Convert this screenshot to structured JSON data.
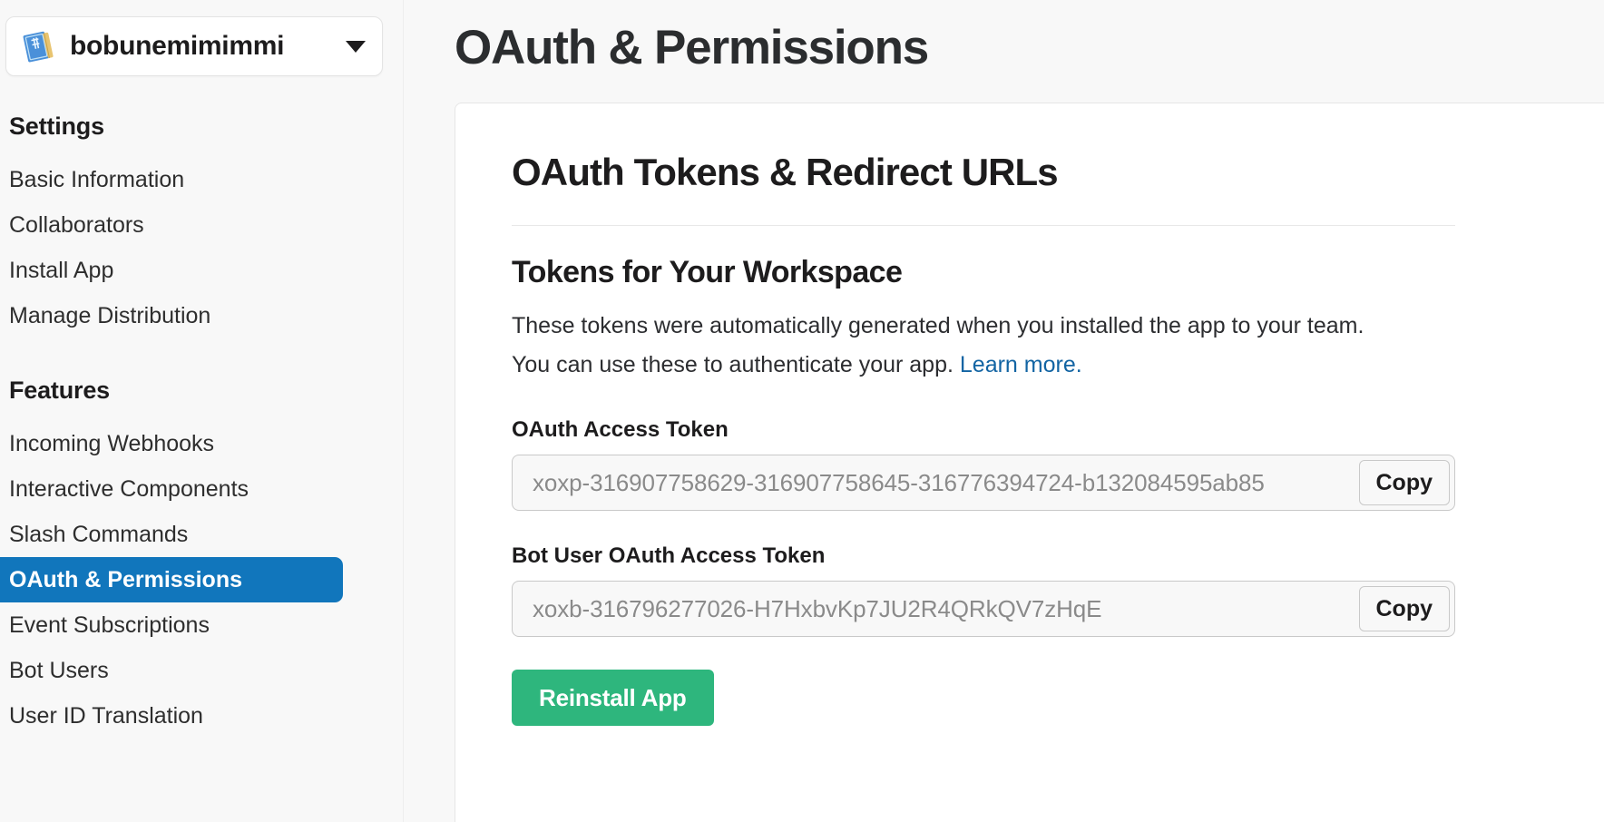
{
  "sidebar": {
    "app_selector": {
      "name": "bobunemimimmi",
      "icon": "blueprint-notebook-emoji",
      "chevron": "chevron-down-icon"
    },
    "sections": [
      {
        "id": "settings",
        "title": "Settings",
        "items": [
          {
            "label": "Basic Information",
            "active": false
          },
          {
            "label": "Collaborators",
            "active": false
          },
          {
            "label": "Install App",
            "active": false
          },
          {
            "label": "Manage Distribution",
            "active": false
          }
        ]
      },
      {
        "id": "features",
        "title": "Features",
        "items": [
          {
            "label": "Incoming Webhooks",
            "active": false
          },
          {
            "label": "Interactive Components",
            "active": false
          },
          {
            "label": "Slash Commands",
            "active": false
          },
          {
            "label": "OAuth & Permissions",
            "active": true
          },
          {
            "label": "Event Subscriptions",
            "active": false
          },
          {
            "label": "Bot Users",
            "active": false
          },
          {
            "label": "User ID Translation",
            "active": false
          }
        ]
      }
    ],
    "active_color": "#1176bc",
    "background": "#f8f8f8"
  },
  "main": {
    "page_title": "OAuth & Permissions",
    "card": {
      "title": "OAuth Tokens & Redirect URLs",
      "section_title": "Tokens for Your Workspace",
      "description_part1": "These tokens were automatically generated when you installed the app to your team. You can use these to authenticate your app. ",
      "description_link": "Learn more.",
      "link_color": "#1264a3",
      "fields": [
        {
          "label": "OAuth Access Token",
          "value": "xoxp-316907758629-316907758645-316776394724-b132084595ab85",
          "copy_label": "Copy"
        },
        {
          "label": "Bot User OAuth Access Token",
          "value": "xoxb-316796277026-H7HxbvKp7JU2R4QRkQV7zHqE",
          "copy_label": "Copy"
        }
      ],
      "reinstall_label": "Reinstall App",
      "reinstall_color": "#2eb67d"
    }
  }
}
